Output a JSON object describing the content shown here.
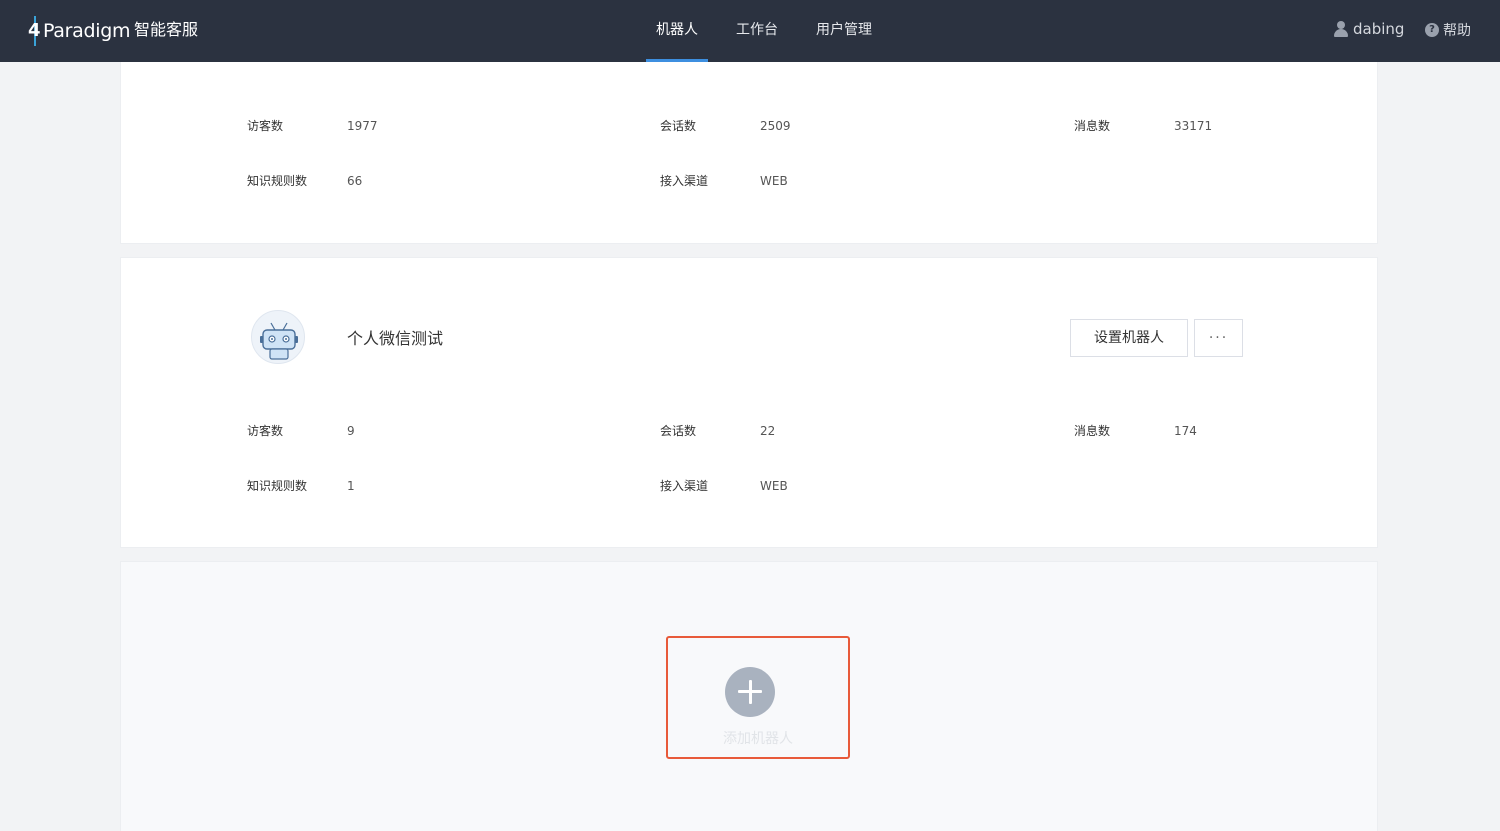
{
  "header": {
    "logo_text": "Paradigm",
    "logo_number": "4",
    "app_title": "智能客服",
    "nav": [
      {
        "label": "机器人",
        "active": true
      },
      {
        "label": "工作台",
        "active": false
      },
      {
        "label": "用户管理",
        "active": false
      }
    ],
    "user_name": "dabing",
    "help_label": "帮助"
  },
  "bots": [
    {
      "name": "",
      "stats": {
        "visitors_label": "访客数",
        "visitors": "1977",
        "sessions_label": "会话数",
        "sessions": "2509",
        "messages_label": "消息数",
        "messages": "33171",
        "rules_label": "知识规则数",
        "rules": "66",
        "channel_label": "接入渠道",
        "channel": "WEB"
      }
    },
    {
      "name": "个人微信测试",
      "config_button": "设置机器人",
      "more_button": "···",
      "stats": {
        "visitors_label": "访客数",
        "visitors": "9",
        "sessions_label": "会话数",
        "sessions": "22",
        "messages_label": "消息数",
        "messages": "174",
        "rules_label": "知识规则数",
        "rules": "1",
        "channel_label": "接入渠道",
        "channel": "WEB"
      }
    }
  ],
  "add_bot": {
    "label": "添加机器人",
    "icon": "plus-icon"
  },
  "colors": {
    "topbar": "#2b3240",
    "nav_active_underline": "#3d8fe0",
    "highlight_border": "#e85a3a",
    "add_icon": "#a9b2bf"
  }
}
